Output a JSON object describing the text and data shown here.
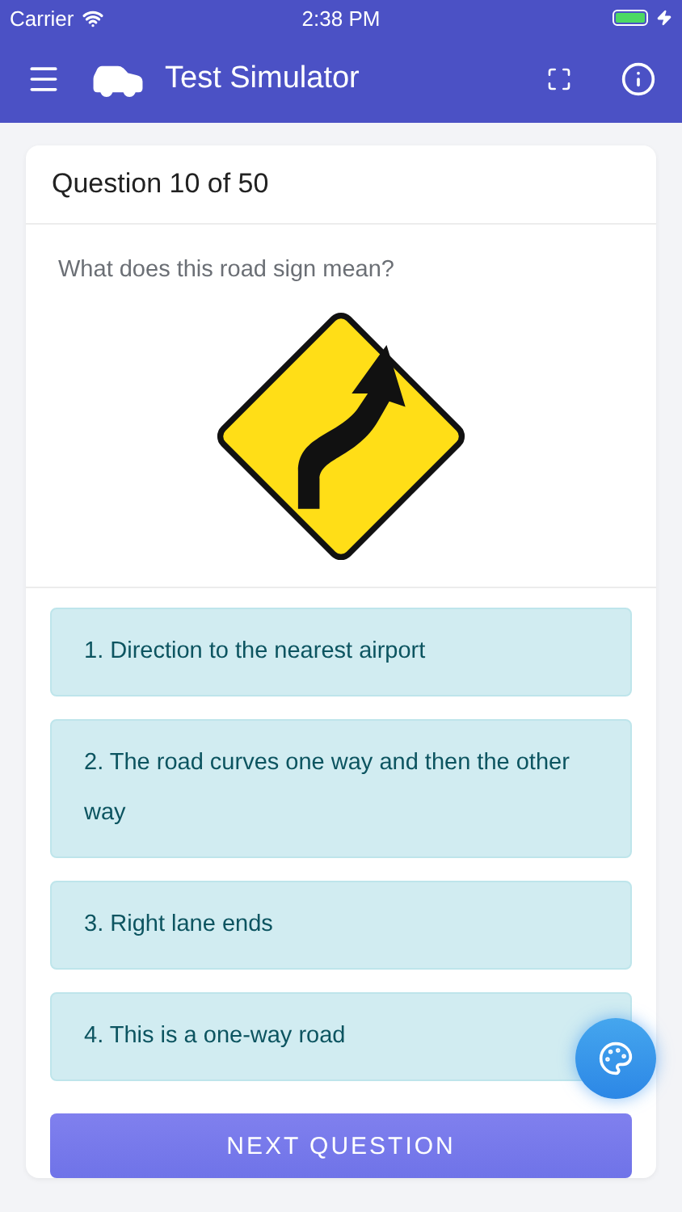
{
  "status_bar": {
    "carrier": "Carrier",
    "time": "2:38 PM"
  },
  "app_bar": {
    "title": "Test Simulator"
  },
  "card": {
    "header": "Question 10 of 50",
    "question": "What does this road sign mean?",
    "answers": [
      {
        "text": "1. Direction to the nearest airport"
      },
      {
        "text": "2. The road curves one way and then the other way"
      },
      {
        "text": "3. Right lane ends"
      },
      {
        "text": "4. This is a one-way road"
      }
    ]
  },
  "next_button": "NEXT QUESTION"
}
